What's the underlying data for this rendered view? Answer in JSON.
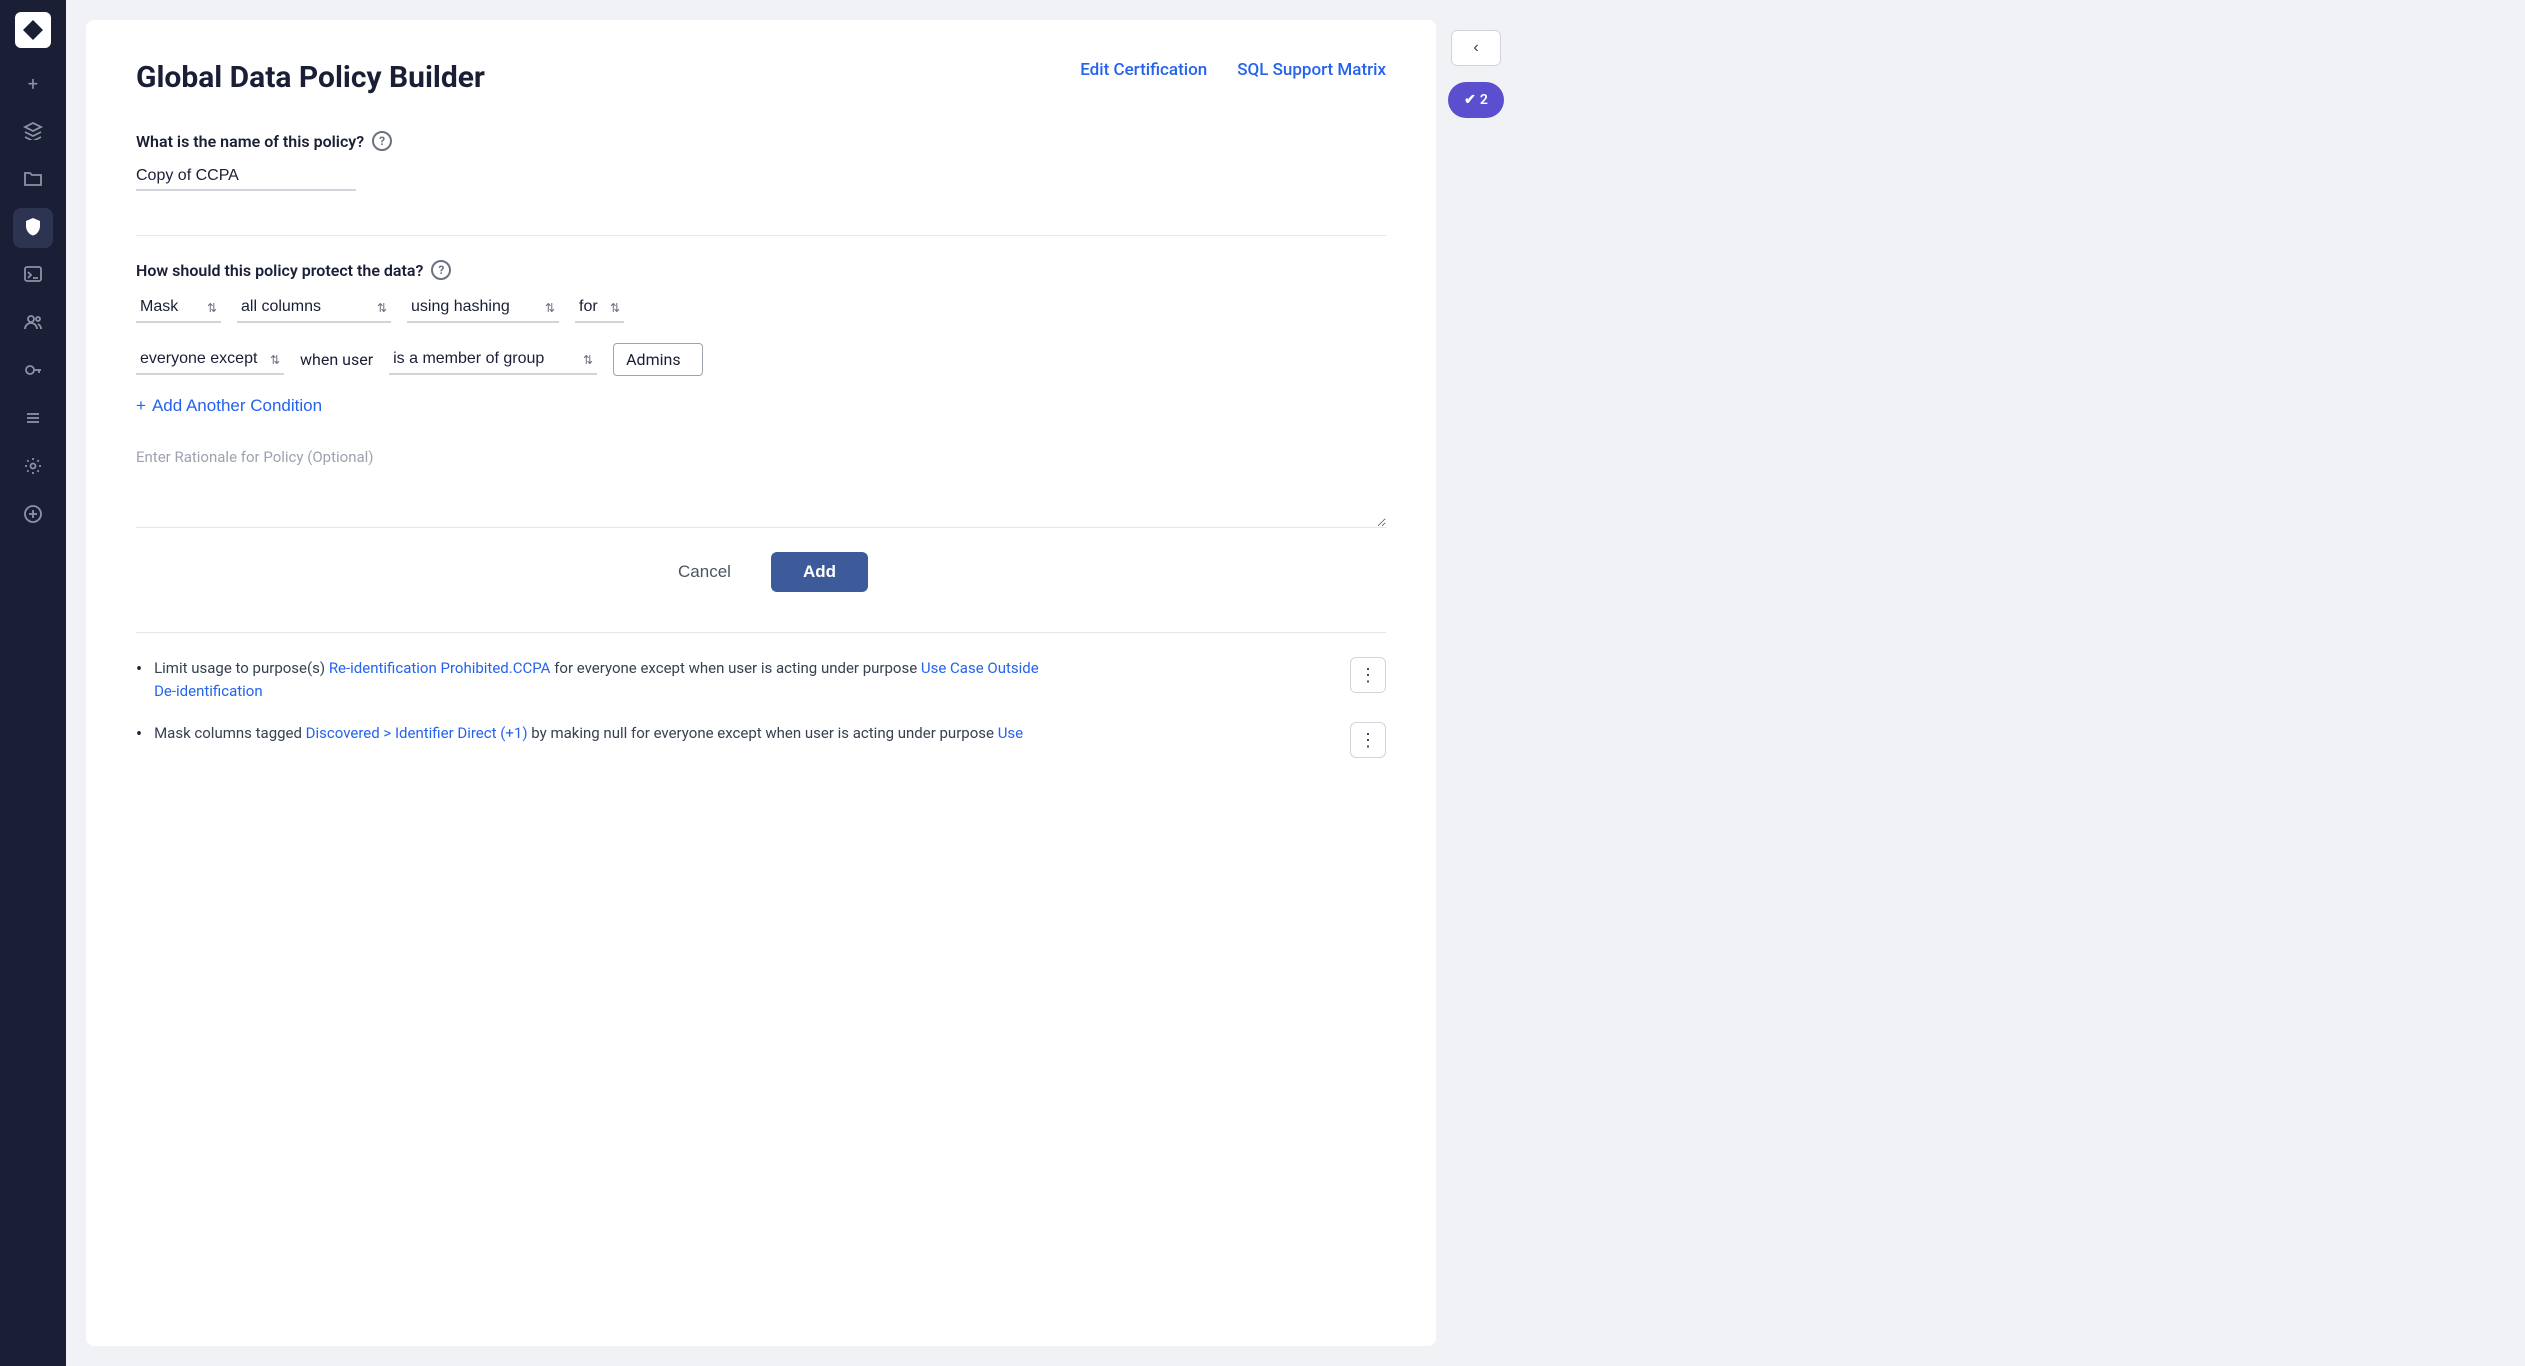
{
  "sidebar": {
    "items": [
      {
        "id": "logo",
        "icon": "◆",
        "label": "Logo"
      },
      {
        "id": "plus",
        "icon": "+",
        "label": "Add"
      },
      {
        "id": "layers",
        "icon": "⊞",
        "label": "Layers"
      },
      {
        "id": "folder",
        "icon": "🗂",
        "label": "Folder"
      },
      {
        "id": "shield",
        "icon": "🛡",
        "label": "Shield",
        "active": true
      },
      {
        "id": "terminal",
        "icon": ">_",
        "label": "Terminal"
      },
      {
        "id": "users",
        "icon": "👥",
        "label": "Users"
      },
      {
        "id": "key",
        "icon": "🔑",
        "label": "Key"
      },
      {
        "id": "list",
        "icon": "☰",
        "label": "List"
      },
      {
        "id": "settings",
        "icon": "⚙",
        "label": "Settings"
      },
      {
        "id": "circle-plus",
        "icon": "⊕",
        "label": "Circle Plus"
      }
    ]
  },
  "page": {
    "title": "Global Data Policy Builder",
    "edit_certification_label": "Edit Certification",
    "sql_support_label": "SQL Support Matrix"
  },
  "form": {
    "policy_name_label": "What is the name of this policy?",
    "policy_name_value": "Copy of CCPA",
    "protection_label": "How should this policy protect the data?",
    "mask_label": "Mask",
    "columns_label": "all columns",
    "hashing_label": "using hashing",
    "for_label": "for",
    "everyone_except_label": "everyone except",
    "when_user_label": "when user",
    "is_member_of_group_label": "is a member of group",
    "admins_tag": "Admins",
    "add_condition_label": "Add Another Condition",
    "rationale_placeholder": "Enter Rationale for Policy (Optional)",
    "cancel_label": "Cancel",
    "add_label": "Add"
  },
  "policies": [
    {
      "id": "policy-1",
      "prefix": "Limit usage to purpose(s) ",
      "link1": "Re-identification Prohibited.CCPA",
      "middle": " for everyone except when user is acting under purpose ",
      "link2": "Use Case Outside De-identification",
      "suffix": ""
    },
    {
      "id": "policy-2",
      "prefix": "Mask columns tagged ",
      "link1": "Discovered > Identifier Direct (+1)",
      "middle": " by making null for everyone except when user is acting under purpose ",
      "link2": "Use",
      "suffix": ""
    }
  ],
  "right_panel": {
    "collapse_icon": "‹",
    "badge_count": "2",
    "badge_icon": "✔"
  }
}
